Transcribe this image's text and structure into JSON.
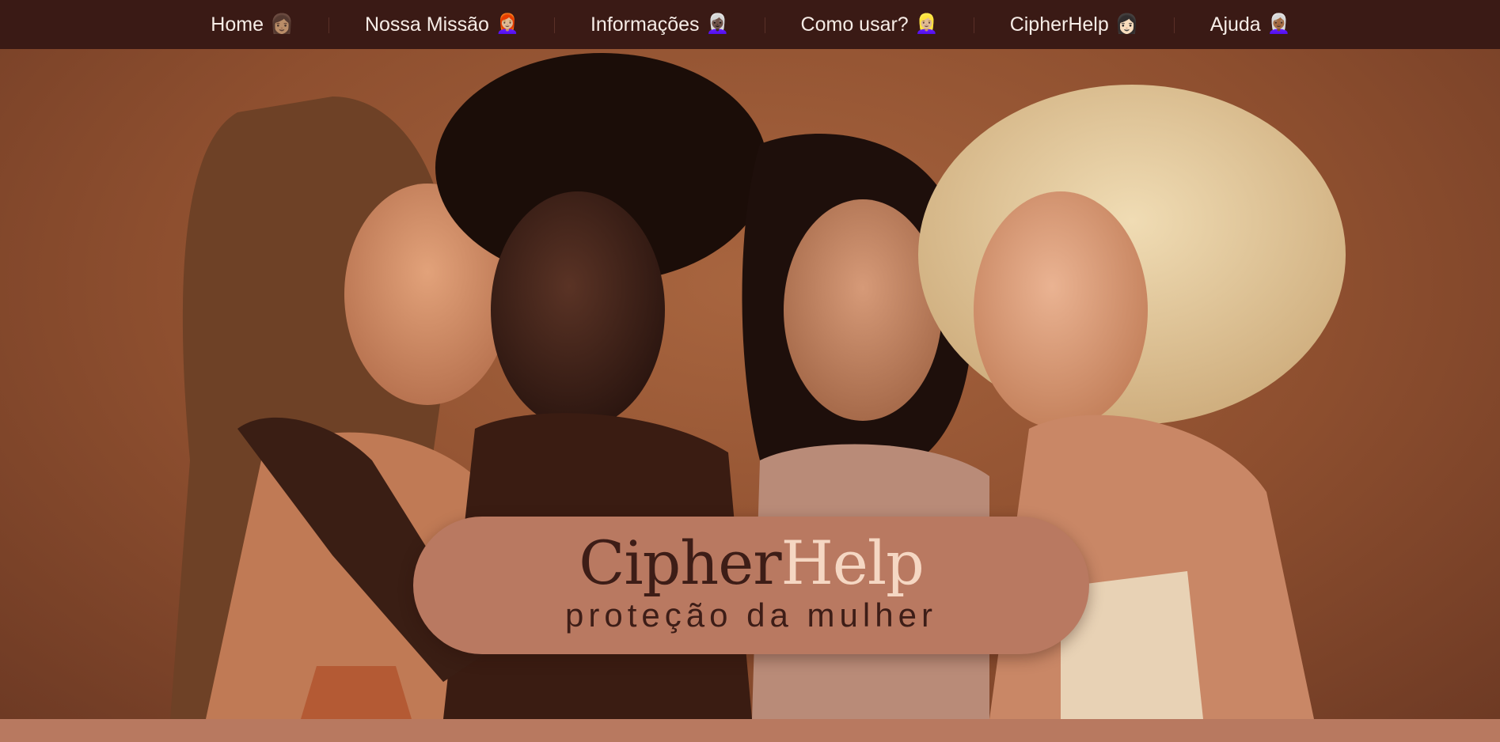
{
  "nav": {
    "items": [
      {
        "label": "Home",
        "emoji": "👩🏽",
        "icon": "woman-medium-skin-icon"
      },
      {
        "label": "Nossa Missão",
        "emoji": "👩🏼‍🦰",
        "icon": "woman-red-hair-icon"
      },
      {
        "label": "Informações",
        "emoji": "👩🏿‍🦳",
        "icon": "woman-white-hair-dark-skin-icon"
      },
      {
        "label": "Como usar?",
        "emoji": "👱🏼‍♀️",
        "icon": "woman-blonde-icon"
      },
      {
        "label": "CipherHelp",
        "emoji": "👩🏻",
        "icon": "woman-light-skin-icon"
      },
      {
        "label": "Ajuda",
        "emoji": "👩🏾‍🦳",
        "icon": "woman-white-hair-icon"
      }
    ]
  },
  "hero": {
    "brand_part1": "Cipher",
    "brand_part2": "Help",
    "tagline": "proteção da mulher"
  },
  "colors": {
    "nav_bg": "#3a1a15",
    "pill_bg": "#b97961",
    "brand_dark": "#3d1d17",
    "brand_light": "#f5d7c3",
    "page_bg": "#b87960"
  }
}
